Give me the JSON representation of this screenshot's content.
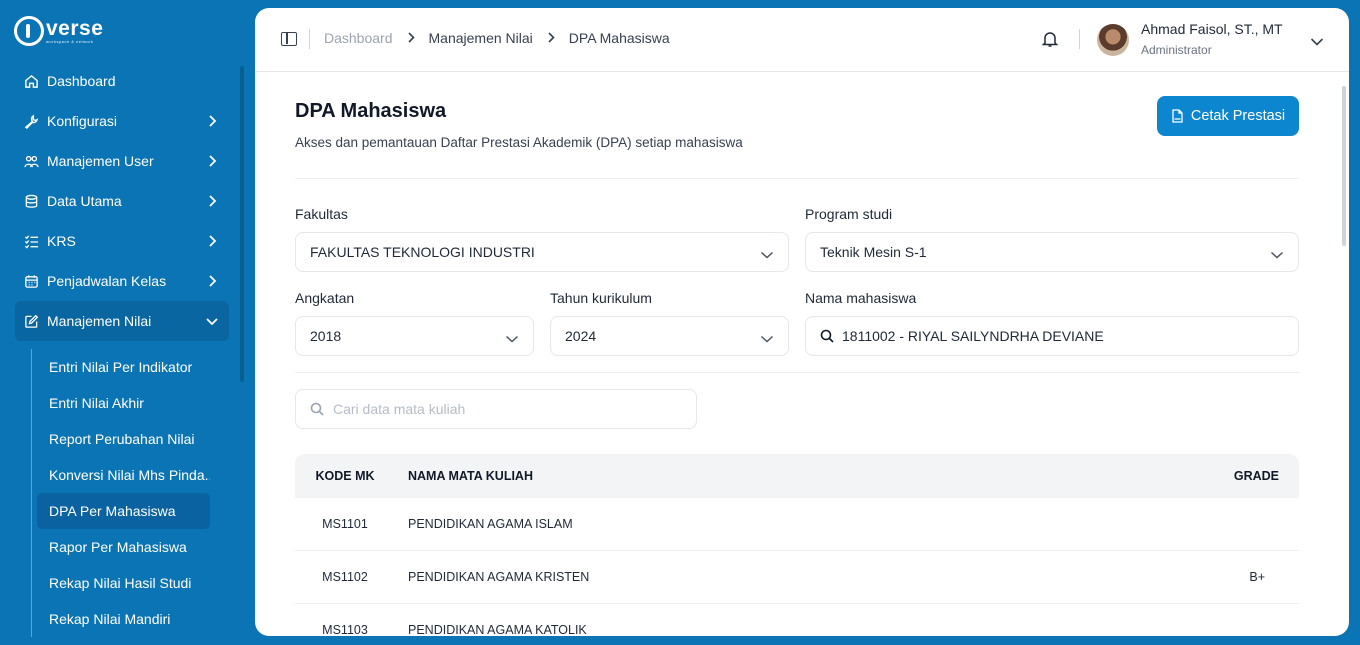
{
  "brand": {
    "name": "verse",
    "tagline": "workspace & network"
  },
  "sidebar": {
    "items": [
      {
        "label": "Dashboard",
        "icon": "home-icon",
        "has_children": false
      },
      {
        "label": "Konfigurasi",
        "icon": "wrench-icon",
        "has_children": true
      },
      {
        "label": "Manajemen User",
        "icon": "users-icon",
        "has_children": true
      },
      {
        "label": "Data Utama",
        "icon": "database-icon",
        "has_children": true
      },
      {
        "label": "KRS",
        "icon": "list-check-icon",
        "has_children": true
      },
      {
        "label": "Penjadwalan Kelas",
        "icon": "calendar-icon",
        "has_children": true
      },
      {
        "label": "Manajemen Nilai",
        "icon": "edit-icon",
        "has_children": true,
        "expanded": true
      }
    ],
    "subitems": [
      {
        "label": "Entri Nilai Per Indikator"
      },
      {
        "label": "Entri Nilai Akhir"
      },
      {
        "label": "Report Perubahan Nilai"
      },
      {
        "label": "Konversi Nilai Mhs Pinda..."
      },
      {
        "label": "DPA Per Mahasiswa",
        "active": true
      },
      {
        "label": "Rapor Per Mahasiswa"
      },
      {
        "label": "Rekap Nilai Hasil Studi"
      },
      {
        "label": "Rekap Nilai Mandiri"
      }
    ]
  },
  "header": {
    "breadcrumb": [
      "Dashboard",
      "Manajemen Nilai",
      "DPA Mahasiswa"
    ],
    "user": {
      "name": "Ahmad Faisol, ST., MT",
      "role": "Administrator"
    }
  },
  "page": {
    "title": "DPA Mahasiswa",
    "description": "Akses dan pemantauan Daftar Prestasi Akademik (DPA) setiap mahasiswa",
    "print_button": "Cetak Prestasi"
  },
  "filters": {
    "fakultas": {
      "label": "Fakultas",
      "value": "FAKULTAS TEKNOLOGI INDUSTRI"
    },
    "program_studi": {
      "label": "Program studi",
      "value": "Teknik Mesin S-1"
    },
    "angkatan": {
      "label": "Angkatan",
      "value": "2018"
    },
    "tahun_kurikulum": {
      "label": "Tahun kurikulum",
      "value": "2024"
    },
    "nama_mahasiswa": {
      "label": "Nama mahasiswa",
      "value": "1811002 - RIYAL SAILYNDRHA DEVIANE"
    }
  },
  "course_search": {
    "placeholder": "Cari data mata kuliah"
  },
  "table": {
    "columns": [
      "KODE MK",
      "NAMA MATA KULIAH",
      "GRADE"
    ],
    "rows": [
      {
        "kode": "MS1101",
        "nama": "PENDIDIKAN AGAMA ISLAM",
        "grade": ""
      },
      {
        "kode": "MS1102",
        "nama": "PENDIDIKAN AGAMA KRISTEN",
        "grade": "B+"
      },
      {
        "kode": "MS1103",
        "nama": "PENDIDIKAN AGAMA KATOLIK",
        "grade": ""
      }
    ]
  },
  "colors": {
    "sidebar_bg": "#0b74b5",
    "accent": "#0b86cf",
    "active_item": "#0a62a0"
  }
}
